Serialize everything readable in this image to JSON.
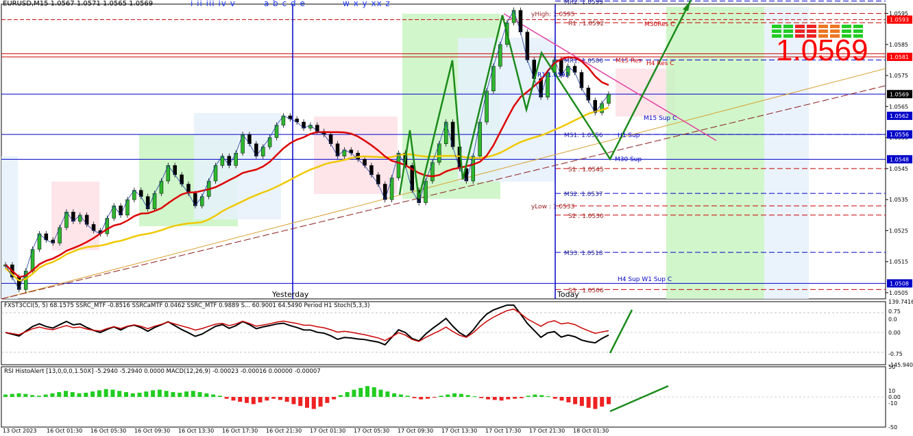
{
  "header": {
    "symbol_line": "EURUSD,M15  1.0567 1.0571 1.0565 1.0569",
    "wave_labels_1": "i ii iii iv v",
    "wave_labels_2": "a b c d e",
    "wave_labels_3": "w x y xx z"
  },
  "big_price": "1.0569",
  "colors": {
    "bull_box": "#c9f5c2",
    "bear_box": "#fde0e6",
    "neutral_box": "#e6f1fc",
    "ma_red": "#dd0000",
    "ma_gold": "#f0c800",
    "pivot_blue": "#0000c8",
    "pivot_red": "#cc0000",
    "arrow_green": "#1a8a1a",
    "price_box_red": "#ff0000",
    "price_box_blue": "#0000c8"
  },
  "chart_data": [
    {
      "type": "line",
      "name": "EURUSD M15 price",
      "ylim": [
        1.0503,
        1.0598
      ],
      "y_ticks": [
        "1.0595",
        "1.0585",
        "1.0575",
        "1.0565",
        "1.0555",
        "1.0545",
        "1.0535",
        "1.0525",
        "1.0515",
        "1.0505"
      ],
      "x_ticks": [
        "13 Oct 2023",
        "16 Oct 01:30",
        "16 Oct 05:30",
        "16 Oct 09:30",
        "16 Oct 13:30",
        "16 Oct 17:30",
        "16 Oct 21:30",
        "17 Oct 01:30",
        "17 Oct 05:30",
        "17 Oct 09:30",
        "17 Oct 13:30",
        "17 Oct 17:30",
        "17 Oct 21:30",
        "18 Oct 01:30"
      ],
      "period_labels": [
        "Yesterday",
        "Today"
      ],
      "close": [
        1.0514,
        1.051,
        1.0506,
        1.0512,
        1.0519,
        1.0524,
        1.0522,
        1.0521,
        1.0526,
        1.0531,
        1.0528,
        1.053,
        1.0527,
        1.0525,
        1.0524,
        1.0529,
        1.0533,
        1.053,
        1.0535,
        1.0538,
        1.0536,
        1.0532,
        1.0537,
        1.0541,
        1.0546,
        1.0543,
        1.054,
        1.0537,
        1.0533,
        1.0536,
        1.0541,
        1.0546,
        1.0549,
        1.0546,
        1.055,
        1.0556,
        1.0553,
        1.0549,
        1.0552,
        1.0555,
        1.0559,
        1.0562,
        1.0561,
        1.056,
        1.0558,
        1.0559,
        1.0557,
        1.0556,
        1.0553,
        1.0549,
        1.0551,
        1.055,
        1.0548,
        1.0546,
        1.0543,
        1.054,
        1.0535,
        1.0542,
        1.055,
        1.0546,
        1.0538,
        1.0534,
        1.0541,
        1.0547,
        1.0553,
        1.056,
        1.0552,
        1.0545,
        1.0541,
        1.0549,
        1.056,
        1.057,
        1.0578,
        1.0585,
        1.0592,
        1.0596,
        1.0589,
        1.058,
        1.0574,
        1.0568,
        1.0576,
        1.058,
        1.0575,
        1.0578,
        1.0576,
        1.0571,
        1.0567,
        1.0563,
        1.0566,
        1.0569
      ],
      "levels": [
        {
          "label": "MR2: 1.0599",
          "value": 1.0599,
          "style": "dash-blue"
        },
        {
          "label": "yHigh: 1.0595",
          "value": 1.0595,
          "style": "dash-red"
        },
        {
          "label": "R1 : 1.0592",
          "value": 1.0592,
          "style": "dash-red"
        },
        {
          "label": "MR1: 1.0580",
          "value": 1.058,
          "style": "dash-blue"
        },
        {
          "label": "MS1: 1.0556",
          "value": 1.0556,
          "style": "dash-blue"
        },
        {
          "label": "S1 : 1.0545",
          "value": 1.0545,
          "style": "dash-red"
        },
        {
          "label": "MS2: 1.0537",
          "value": 1.0537,
          "style": "dash-blue"
        },
        {
          "label": "yLow : 1.0533",
          "value": 1.0533,
          "style": "dash-red"
        },
        {
          "label": "S2 : 1.0530",
          "value": 1.053,
          "style": "dash-red"
        },
        {
          "label": "MS3: 1.0518",
          "value": 1.0518,
          "style": "dash-blue"
        },
        {
          "label": "S3 : 1.0506",
          "value": 1.0506,
          "style": "dash-red"
        }
      ],
      "zone_labels": [
        {
          "label": "M15 Res",
          "value": 1.058,
          "color": "#cc0000"
        },
        {
          "label": "H4 Res C",
          "value": 1.0578,
          "color": "#cc0000"
        },
        {
          "label": "M30Res C",
          "value": 1.0592,
          "color": "#cc0000"
        },
        {
          "label": "M15 Sup C",
          "value": 1.056,
          "color": "#0000c8"
        },
        {
          "label": "H1 Sup",
          "value": 1.0554,
          "color": "#0000c8"
        },
        {
          "label": "M30 Sup",
          "value": 1.0546,
          "color": "#0000c8"
        },
        {
          "label": "H4 Sup  W1 Sup C",
          "value": 1.0507,
          "color": "#0000c8"
        },
        {
          "label": "R1 1.0592",
          "value": 1.0569,
          "color": "#0000c8"
        }
      ],
      "price_boxes": [
        {
          "label": "1.0593",
          "value": 1.0593,
          "color": "#ff0000"
        },
        {
          "label": "1.0581",
          "value": 1.0581,
          "color": "#ff0000"
        },
        {
          "label": "1.0569",
          "value": 1.0569,
          "color": "#000000"
        },
        {
          "label": "1.0562",
          "value": 1.0562,
          "color": "#0000c8"
        },
        {
          "label": "1.0556",
          "value": 1.0556,
          "color": "#0000c8"
        },
        {
          "label": "1.0548",
          "value": 1.0548,
          "color": "#0000c8"
        },
        {
          "label": "1.0508",
          "value": 1.0508,
          "color": "#0000c8"
        }
      ]
    },
    {
      "type": "line",
      "name": "Oscillator panel",
      "header": "FXST3CCI(5, 5) 68.1575  SSRC_MTF -0.8516  SSRCaMTF 0.0462  SSRC_MTF 0.9889  S... 60.9001 64.5490  Period H1 Stoch(5,3,3)",
      "y_ticks": [
        "139.7416",
        "0.75",
        "0.0",
        "0.00",
        "-0.75",
        "-145.940"
      ],
      "ylim": [
        -145.94,
        139.7416
      ]
    },
    {
      "type": "bar",
      "name": "RSI HistoAlert / MACD",
      "header": "RSI HistoAlert [13,0,0,0,1.50X] -5.2940 -5.2940 0.0000  MACD(12,26,9) -0.00023 -0.00016 0.00000 -0.00007",
      "y_ticks": [
        "50",
        "10",
        "0.00",
        "-10",
        "-50"
      ],
      "ylim": [
        -50,
        50
      ],
      "values": [
        4,
        5,
        6,
        5,
        3,
        2,
        4,
        6,
        8,
        10,
        8,
        6,
        7,
        9,
        11,
        13,
        12,
        10,
        8,
        6,
        7,
        9,
        11,
        12,
        10,
        8,
        7,
        9,
        10,
        8,
        6,
        4,
        2,
        -3,
        -6,
        -8,
        -10,
        -12,
        -9,
        -6,
        -3,
        -5,
        -8,
        -12,
        -15,
        -18,
        -20,
        -16,
        -10,
        -4,
        3,
        8,
        12,
        15,
        18,
        16,
        12,
        9,
        6,
        4,
        2,
        -2,
        -4,
        -3,
        -1,
        2,
        4,
        6,
        5,
        3,
        1,
        -2,
        -4,
        -5,
        -6,
        -4,
        -3,
        -2,
        2,
        4,
        3,
        1,
        -3,
        -6,
        -9,
        -12,
        -15,
        -18,
        -20,
        -16,
        -12
      ]
    }
  ]
}
